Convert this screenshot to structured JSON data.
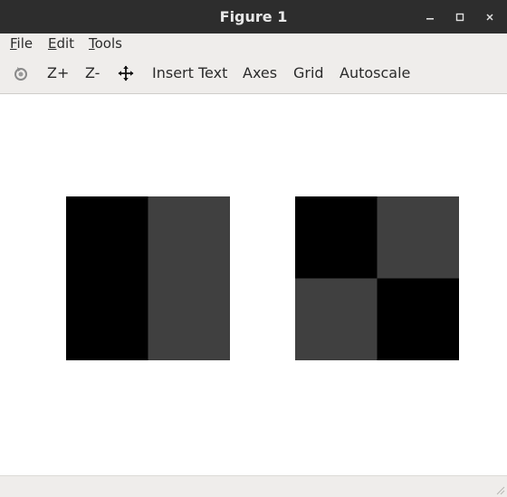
{
  "window": {
    "title": "Figure 1",
    "controls": [
      "minimize",
      "maximize",
      "close"
    ]
  },
  "menu": {
    "file": {
      "mnemonic": "F",
      "rest": "ile"
    },
    "edit": {
      "mnemonic": "E",
      "rest": "dit"
    },
    "tools": {
      "mnemonic": "T",
      "rest": "ools"
    }
  },
  "toolbar": {
    "rotate_icon": "rotate-icon",
    "zoom_in": "Z+",
    "zoom_out": "Z-",
    "pan_icon": "pan-icon",
    "insert_text": "Insert Text",
    "axes": "Axes",
    "grid": "Grid",
    "autoscale": "Autoscale"
  },
  "colors": {
    "cell_black": "#000000",
    "cell_gray": "#404040",
    "titlebar": "#2d2d2d",
    "toolbar": "#efedeb"
  },
  "chart_data": [
    {
      "type": "heatmap",
      "rows": 2,
      "cols": 2,
      "values": [
        [
          0,
          1
        ],
        [
          0,
          1
        ]
      ],
      "colormap": {
        "0": "#000000",
        "1": "#404040"
      }
    },
    {
      "type": "heatmap",
      "rows": 2,
      "cols": 2,
      "values": [
        [
          0,
          1
        ],
        [
          1,
          0
        ]
      ],
      "colormap": {
        "0": "#000000",
        "1": "#404040"
      }
    }
  ]
}
